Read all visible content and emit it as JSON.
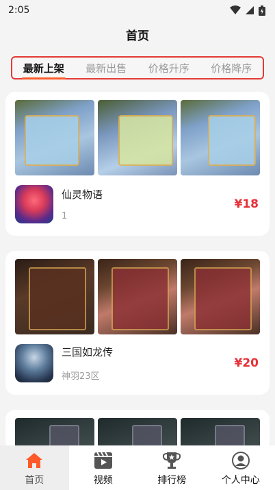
{
  "status_bar": {
    "time": "2:05"
  },
  "header": {
    "title": "首页"
  },
  "tabs": [
    {
      "label": "最新上架",
      "active": true
    },
    {
      "label": "最新出售",
      "active": false
    },
    {
      "label": "价格升序",
      "active": false
    },
    {
      "label": "价格降序",
      "active": false
    }
  ],
  "listings": [
    {
      "name": "仙灵物语",
      "sub": "1",
      "price": "¥18"
    },
    {
      "name": "三国如龙传",
      "sub": "神羽23区",
      "price": "¥20"
    }
  ],
  "tabbar": [
    {
      "label": "首页",
      "icon": "home-icon",
      "active": true
    },
    {
      "label": "视频",
      "icon": "video-icon",
      "active": false
    },
    {
      "label": "排行榜",
      "icon": "trophy-icon",
      "active": false
    },
    {
      "label": "个人中心",
      "icon": "user-icon",
      "active": false
    }
  ],
  "colors": {
    "accent": "#ff5a2a",
    "price": "#e5323a",
    "tab_border": "#e53935"
  }
}
